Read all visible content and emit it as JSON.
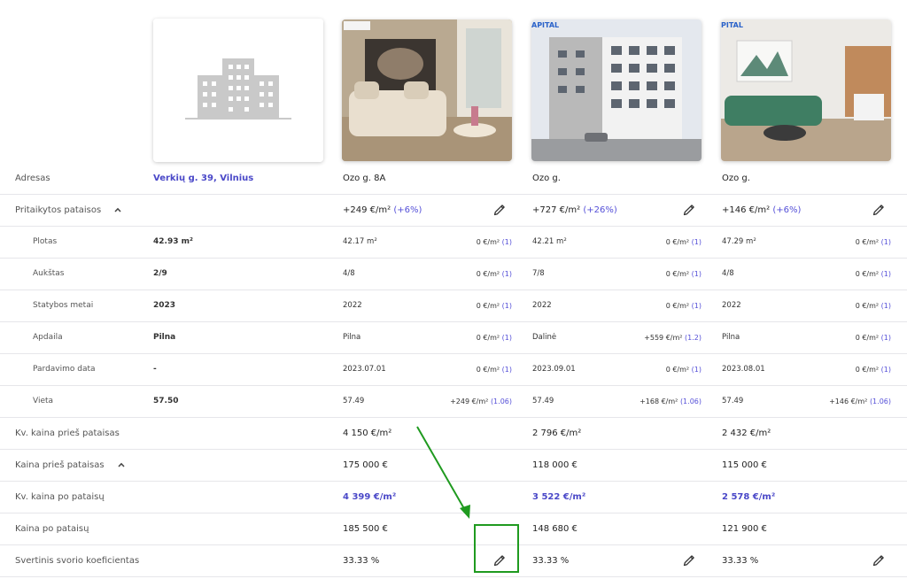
{
  "photos": {
    "subject_icon": "building-placeholder-icon",
    "comp1_badge": "",
    "comp2_badge": "APITAL",
    "comp3_badge": "PITAL"
  },
  "rows": {
    "address": {
      "label": "Adresas",
      "subject": "Verkių g. 39, Vilnius",
      "c1": "Ozo g. 8A",
      "c2": "Ozo g.",
      "c3": "Ozo g."
    },
    "adjustments": {
      "label": "Pritaikytos pataisos",
      "c1": "+249 €/m²",
      "c1_pct": "(+6%)",
      "c2": "+727 €/m²",
      "c2_pct": "(+26%)",
      "c3": "+146 €/m²",
      "c3_pct": "(+6%)"
    },
    "area": {
      "label": "Plotas",
      "subject": "42.93 m²",
      "c1": "42.17 m²",
      "c1_adj": "0 €/m²",
      "c1_k": "(1)",
      "c2": "42.21 m²",
      "c2_adj": "0 €/m²",
      "c2_k": "(1)",
      "c3": "47.29 m²",
      "c3_adj": "0 €/m²",
      "c3_k": "(1)"
    },
    "floor": {
      "label": "Aukštas",
      "subject": "2/9",
      "c1": "4/8",
      "c1_adj": "0 €/m²",
      "c1_k": "(1)",
      "c2": "7/8",
      "c2_adj": "0 €/m²",
      "c2_k": "(1)",
      "c3": "4/8",
      "c3_adj": "0 €/m²",
      "c3_k": "(1)"
    },
    "year": {
      "label": "Statybos metai",
      "subject": "2023",
      "c1": "2022",
      "c1_adj": "0 €/m²",
      "c1_k": "(1)",
      "c2": "2022",
      "c2_adj": "0 €/m²",
      "c2_k": "(1)",
      "c3": "2022",
      "c3_adj": "0 €/m²",
      "c3_k": "(1)"
    },
    "finish": {
      "label": "Apdaila",
      "subject": "Pilna",
      "c1": "Pilna",
      "c1_adj": "0 €/m²",
      "c1_k": "(1)",
      "c2": "Dalinė",
      "c2_adj": "+559 €/m²",
      "c2_k": "(1.2)",
      "c3": "Pilna",
      "c3_adj": "0 €/m²",
      "c3_k": "(1)"
    },
    "sale_date": {
      "label": "Pardavimo data",
      "subject": "-",
      "c1": "2023.07.01",
      "c1_adj": "0 €/m²",
      "c1_k": "(1)",
      "c2": "2023.09.01",
      "c2_adj": "0 €/m²",
      "c2_k": "(1)",
      "c3": "2023.08.01",
      "c3_adj": "0 €/m²",
      "c3_k": "(1)"
    },
    "location": {
      "label": "Vieta",
      "subject": "57.50",
      "c1": "57.49",
      "c1_adj": "+249 €/m²",
      "c1_k": "(1.06)",
      "c2": "57.49",
      "c2_adj": "+168 €/m²",
      "c2_k": "(1.06)",
      "c3": "57.49",
      "c3_adj": "+146 €/m²",
      "c3_k": "(1.06)"
    },
    "sqm_before": {
      "label": "Kv. kaina prieš pataisas",
      "c1": "4 150 €/m²",
      "c2": "2 796 €/m²",
      "c3": "2 432 €/m²"
    },
    "price_before": {
      "label": "Kaina prieš pataisas",
      "c1": "175 000 €",
      "c2": "118 000 €",
      "c3": "115 000 €"
    },
    "sqm_after": {
      "label": "Kv. kaina po pataisų",
      "c1": "4 399 €/m²",
      "c2": "3 522 €/m²",
      "c3": "2 578 €/m²"
    },
    "price_after": {
      "label": "Kaina po pataisų",
      "c1": "185 500 €",
      "c2": "148 680 €",
      "c3": "121 900 €"
    },
    "weight": {
      "label": "Svertinis svorio koeficientas",
      "c1": "33.33 %",
      "c2": "33.33 %",
      "c3": "33.33 %"
    }
  },
  "colors": {
    "accent": "#4a48c8",
    "annotation": "#1f9a1f"
  }
}
